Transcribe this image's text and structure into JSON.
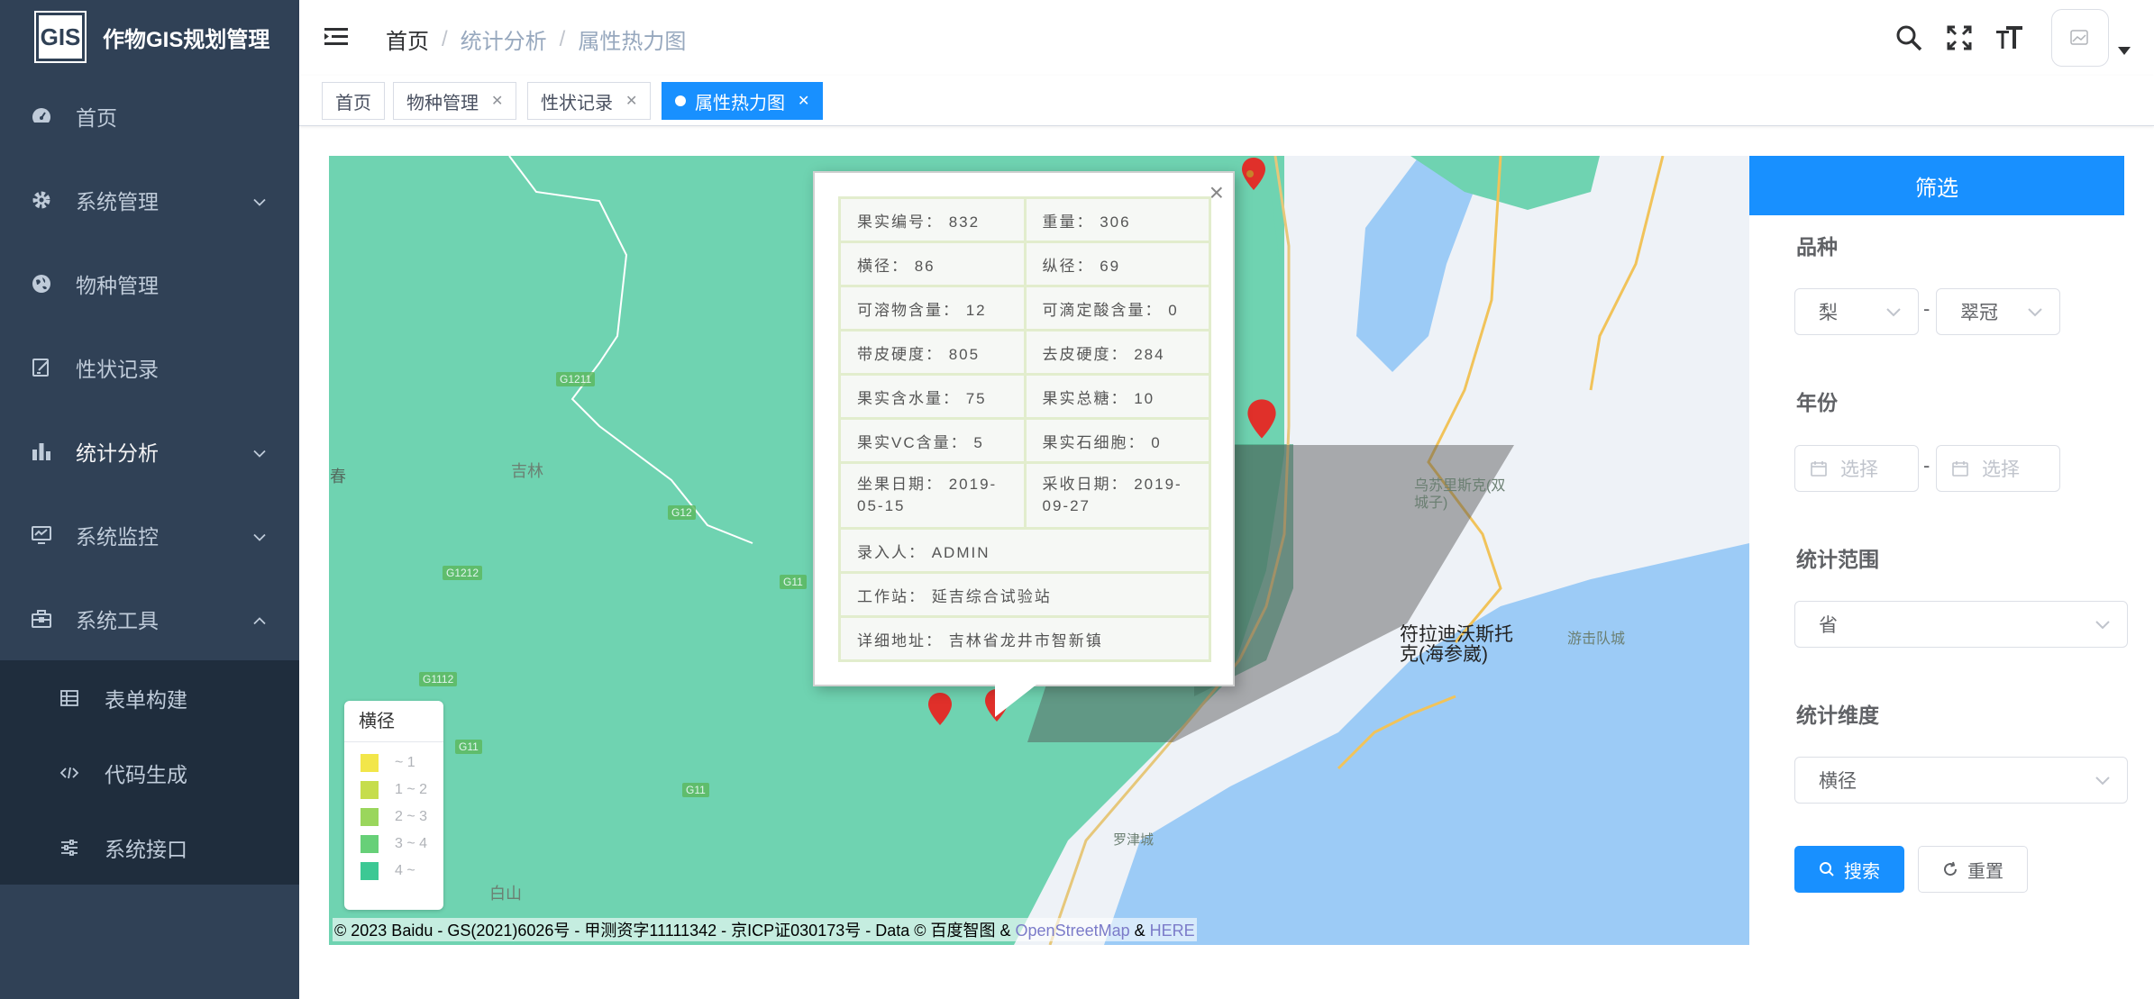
{
  "app": {
    "logo_text": "GIS",
    "title": "作物GIS规划管理"
  },
  "sidebar": {
    "items": [
      {
        "label": "首页",
        "icon": "dashboard-icon",
        "has_children": false
      },
      {
        "label": "系统管理",
        "icon": "gear-icon",
        "has_children": true
      },
      {
        "label": "物种管理",
        "icon": "globe-icon",
        "has_children": false
      },
      {
        "label": "性状记录",
        "icon": "edit-icon",
        "has_children": false
      },
      {
        "label": "统计分析",
        "icon": "bar-chart-icon",
        "has_children": true
      },
      {
        "label": "系统监控",
        "icon": "monitor-icon",
        "has_children": true
      },
      {
        "label": "系统工具",
        "icon": "toolbox-icon",
        "has_children": true,
        "expanded": true
      }
    ],
    "sub_items": [
      {
        "label": "表单构建",
        "icon": "table-icon"
      },
      {
        "label": "代码生成",
        "icon": "code-icon"
      },
      {
        "label": "系统接口",
        "icon": "sliders-icon"
      }
    ]
  },
  "breadcrumb": [
    "首页",
    "统计分析",
    "属性热力图"
  ],
  "tags": [
    {
      "label": "首页",
      "closable": false,
      "active": false
    },
    {
      "label": "物种管理",
      "closable": true,
      "active": false
    },
    {
      "label": "性状记录",
      "closable": true,
      "active": false
    },
    {
      "label": "属性热力图",
      "closable": true,
      "active": true
    }
  ],
  "map": {
    "cities": [
      "吉林",
      "白山",
      "罗津城",
      "乌苏里斯克(双城子)",
      "游击队城"
    ],
    "city_big": [
      "符拉迪沃斯托克(海参崴)"
    ],
    "edge_label": "春",
    "roads": [
      "G1211",
      "G12",
      "G1212",
      "G11",
      "G1112",
      "G11",
      "G11"
    ],
    "copyright_prefix": "© 2023 Baidu - GS(2021)6026号 - 甲测资字11111342 - 京ICP证030173号 - Data © 百度智图 &",
    "osm": "OpenStreetMap",
    "amp": "&",
    "here": "HERE",
    "colors": {
      "land": "#6fd3b1",
      "sea": "#9ccbf6",
      "coast": "#eef2f7"
    }
  },
  "legend": {
    "title": "横径",
    "rows": [
      {
        "label": "~ 1",
        "color": "#f2e64a"
      },
      {
        "label": "1 ~ 2",
        "color": "#c6dd4c"
      },
      {
        "label": "2 ~ 3",
        "color": "#9ad65c"
      },
      {
        "label": "3 ~ 4",
        "color": "#67d078"
      },
      {
        "label": "4 ~",
        "color": "#3cc894"
      }
    ]
  },
  "popup": {
    "rows": [
      [
        "果实编号： 832",
        "重量： 306"
      ],
      [
        "横径： 86",
        "纵径： 69"
      ],
      [
        "可溶物含量： 12",
        "可滴定酸含量： 0"
      ],
      [
        "带皮硬度： 805",
        "去皮硬度： 284"
      ],
      [
        "果实含水量： 75",
        "果实总糖： 10"
      ],
      [
        "果实VC含量： 5",
        "果实石细胞： 0"
      ],
      [
        "坐果日期： 2019-05-15",
        "采收日期： 2019-09-27"
      ]
    ],
    "full_rows": [
      "录入人： ADMIN",
      "工作站： 延吉综合试验站",
      "详细地址： 吉林省龙井市智新镇"
    ],
    "close": "×"
  },
  "filter": {
    "header": "筛选",
    "variety_label": "品种",
    "variety_value_1": "梨",
    "variety_value_2": "翠冠",
    "dash": "-",
    "year_label": "年份",
    "year_placeholder": "选择",
    "scope_label": "统计范围",
    "scope_value": "省",
    "dimension_label": "统计维度",
    "dimension_value": "横径",
    "search_label": "搜索",
    "reset_label": "重置"
  }
}
